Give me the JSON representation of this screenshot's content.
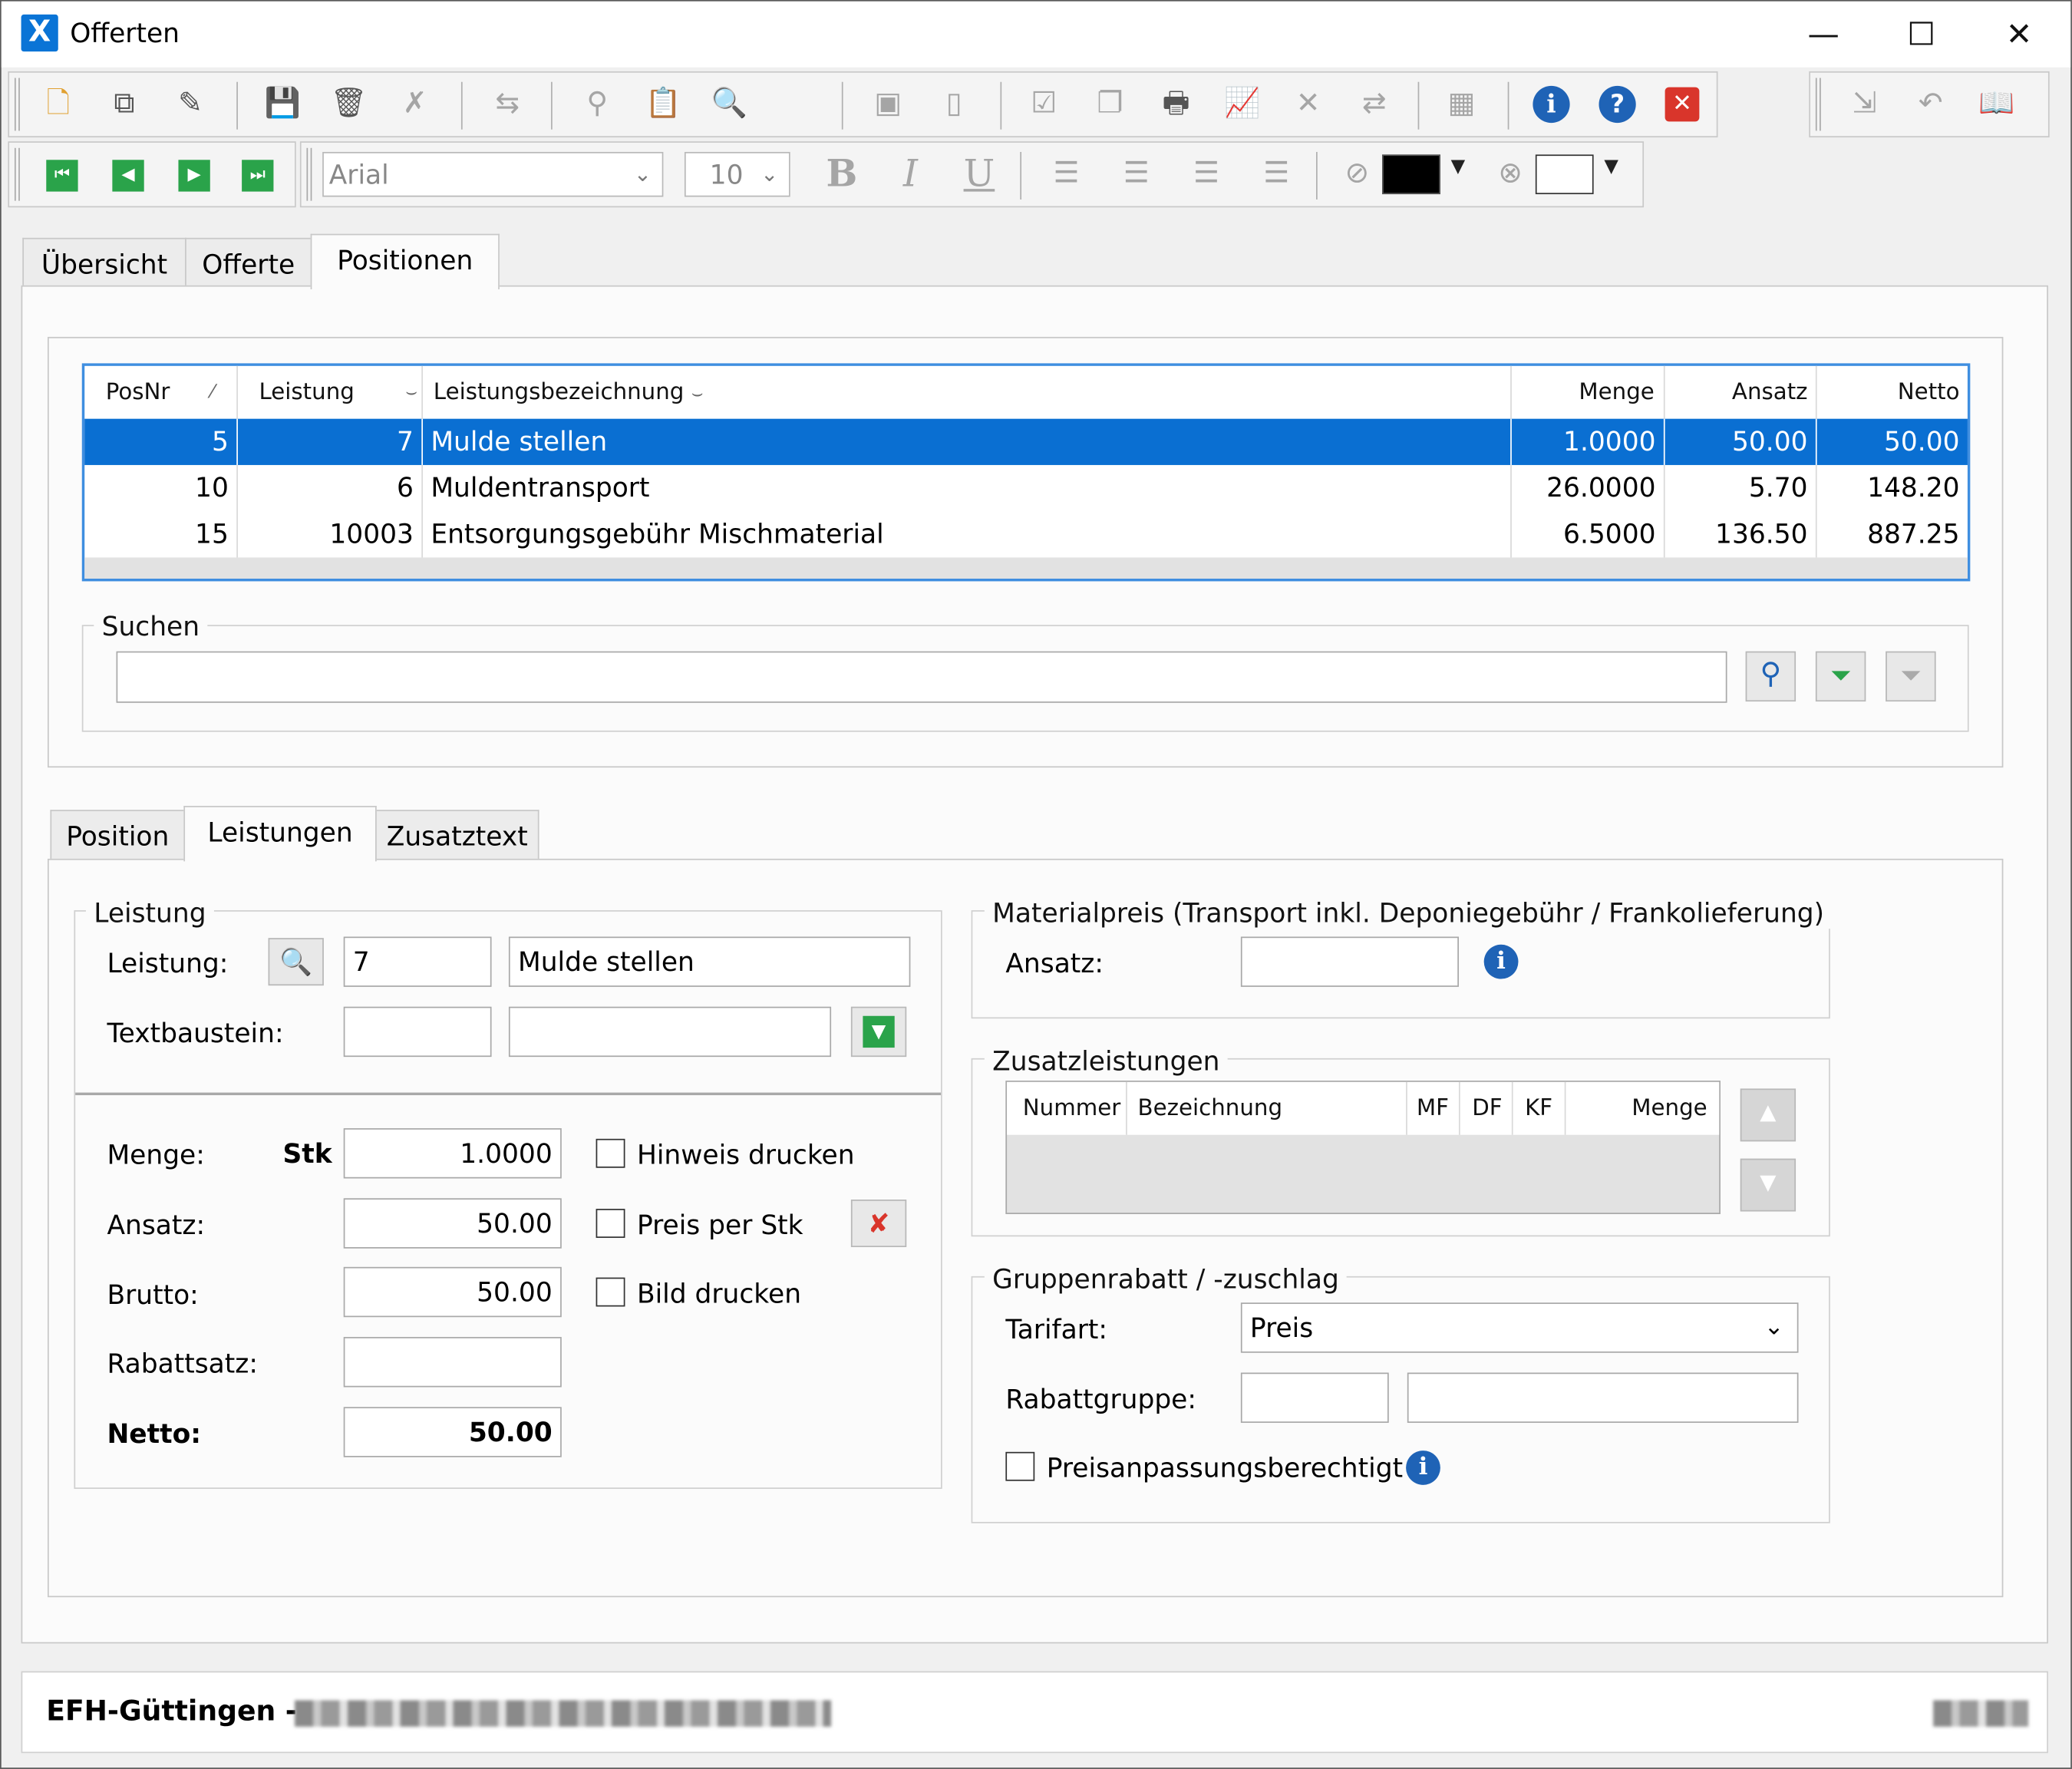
{
  "window": {
    "title": "Offerten",
    "app_icon": "X",
    "minimize": "—",
    "maximize": "☐",
    "close": "✕"
  },
  "toolbar_format": {
    "font": "Arial",
    "size": "10",
    "bold": "B",
    "italic": "I",
    "underline": "U",
    "fore_color": "#000000",
    "back_color": "#ffffff"
  },
  "tabs_top": [
    "Übersicht",
    "Offerte",
    "Positionen"
  ],
  "grid": {
    "columns": [
      "PosNr",
      "Leistung",
      "Leistungsbezeichnung",
      "Menge",
      "Ansatz",
      "Netto"
    ],
    "rows": [
      {
        "posnr": "5",
        "leistung": "7",
        "bezeichnung": "Mulde stellen",
        "menge": "1.0000",
        "ansatz": "50.00",
        "netto": "50.00"
      },
      {
        "posnr": "10",
        "leistung": "6",
        "bezeichnung": "Muldentransport",
        "menge": "26.0000",
        "ansatz": "5.70",
        "netto": "148.20"
      },
      {
        "posnr": "15",
        "leistung": "10003",
        "bezeichnung": "Entsorgungsgebühr Mischmaterial",
        "menge": "6.5000",
        "ansatz": "136.50",
        "netto": "887.25"
      }
    ],
    "selected_row": 0
  },
  "search": {
    "legend": "Suchen",
    "value": ""
  },
  "tabs_bottom": [
    "Position",
    "Leistungen",
    "Zusatztext"
  ],
  "leistung_group": {
    "legend": "Leistung",
    "leistung_label": "Leistung:",
    "leistung_nr": "7",
    "leistung_name": "Mulde stellen",
    "textbaustein_label": "Textbaustein:",
    "textbaustein_nr": "",
    "textbaustein_name": ""
  },
  "amounts": {
    "menge_label": "Menge:",
    "unit": "Stk",
    "menge": "1.0000",
    "ansatz_label": "Ansatz:",
    "ansatz": "50.00",
    "brutto_label": "Brutto:",
    "brutto": "50.00",
    "rabattsatz_label": "Rabattsatz:",
    "rabattsatz": "",
    "netto_label": "Netto:",
    "netto": "50.00",
    "hinweis_drucken": "Hinweis drucken",
    "preis_per_stk": "Preis per Stk",
    "bild_drucken": "Bild drucken"
  },
  "materialpreis": {
    "legend": "Materialpreis (Transport inkl. Deponiegebühr / Frankolieferung)",
    "ansatz_label": "Ansatz:",
    "ansatz": ""
  },
  "zusatzleistungen": {
    "legend": "Zusatzleistungen",
    "columns": [
      "Nummer",
      "Bezeichnung",
      "MF",
      "DF",
      "KF",
      "Menge"
    ]
  },
  "gruppenrabatt": {
    "legend": "Gruppenrabatt / -zuschlag",
    "tarifart_label": "Tarifart:",
    "tarifart": "Preis",
    "rabattgruppe_label": "Rabattgruppe:",
    "rabattgruppe_nr": "",
    "rabattgruppe_name": "",
    "preisanpassung": "Preisanpassungsberechtigt"
  },
  "status": {
    "text": "EFH-Güttingen -"
  }
}
